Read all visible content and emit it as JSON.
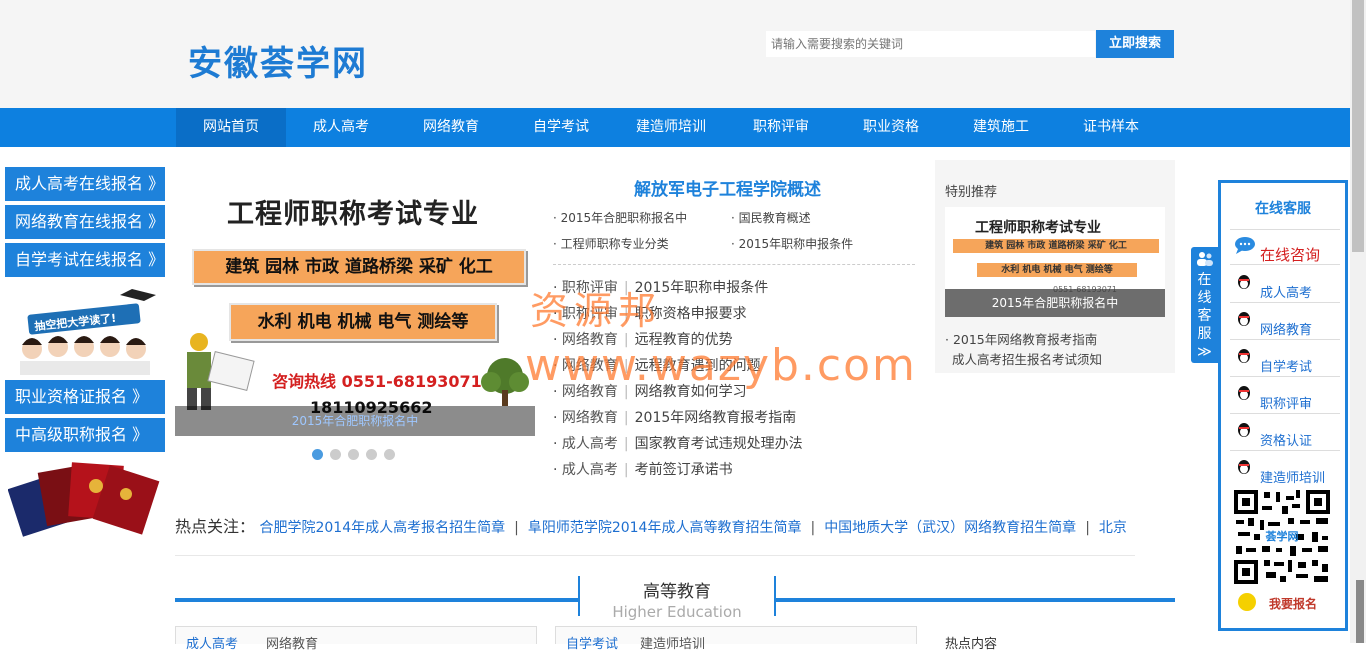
{
  "header": {
    "logo": "安徽荟学网",
    "search_placeholder": "请输入需要搜索的关键词",
    "search_button": "立即搜索"
  },
  "nav": [
    "网站首页",
    "成人高考",
    "网络教育",
    "自学考试",
    "建造师培训",
    "职称评审",
    "职业资格",
    "建筑施工",
    "证书样本"
  ],
  "left_buttons": [
    "成人高考在线报名 》",
    "网络教育在线报名 》",
    "自学考试在线报名 》",
    "职业资格证报名 》",
    "中高级职称报名 》"
  ],
  "promo_text": "抽空把大学读了!",
  "banner": {
    "title": "工程师职称考试专业",
    "tag1": "建筑 园林 市政 道路桥梁 采矿 化工",
    "tag2": "水利 机电 机械 电气 测绘等",
    "hotline": "咨询热线  0551-68193071",
    "phone2": "18110925662",
    "caption": "2015年合肥职称报名中"
  },
  "news": {
    "headline": "解放军电子工程学院概述",
    "top_links": [
      "2015年合肥职称报名中",
      "国民教育概述",
      "工程师职称专业分类",
      "2015年职称申报条件"
    ],
    "rows": [
      {
        "cat": "职称评审",
        "title": "2015年职称申报条件"
      },
      {
        "cat": "职称评审",
        "title": "职称资格申报要求"
      },
      {
        "cat": "网络教育",
        "title": "远程教育的优势"
      },
      {
        "cat": "网络教育",
        "title": "远程教育遇到的问题"
      },
      {
        "cat": "网络教育",
        "title": "网络教育如何学习"
      },
      {
        "cat": "网络教育",
        "title": "2015年网络教育报考指南"
      },
      {
        "cat": "成人高考",
        "title": "国家教育考试违规处理办法"
      },
      {
        "cat": "成人高考",
        "title": "考前签订承诺书"
      }
    ]
  },
  "recommend": {
    "title": "特别推荐",
    "img_title": "工程师职称考试专业",
    "img_tag1": "建筑 园林 市政 道路桥梁 采矿 化工",
    "img_tag2": "水利 机电 机械 电气 测绘等",
    "img_phone": "0551-68193071",
    "img_caption": "2015年合肥职称报名中",
    "items": [
      "· 2015年网络教育报考指南",
      "成人高考招生报名考试须知"
    ]
  },
  "hot": {
    "label": "热点关注：",
    "links": [
      "合肥学院2014年成人高考报名招生简章",
      "阜阳师范学院2014年成人高等教育招生简章",
      "中国地质大学（武汉）网络教育招生简章",
      "北京"
    ]
  },
  "section": {
    "title_cn": "高等教育",
    "title_en": "Higher Education"
  },
  "tabs": {
    "left": [
      "成人高考",
      "网络教育"
    ],
    "mid": [
      "自学考试",
      "建造师培训"
    ],
    "right": "热点内容"
  },
  "float_tab": [
    "在",
    "线",
    "客",
    "服",
    "≫"
  ],
  "cs": {
    "title": "在线客服",
    "consult": "在线咨询",
    "items": [
      "成人高考",
      "网络教育",
      "自学考试",
      "职称评审",
      "资格认证",
      "建造师培训"
    ],
    "qr_text": "荟学网",
    "signup": "我要报名"
  },
  "watermark": {
    "line1": "资源邦",
    "line2": "www.wazyb.com"
  },
  "colors": {
    "primary": "#1e82db",
    "nav": "#0d80e0",
    "accent": "#d42020",
    "banner_tag": "#f6a55a"
  }
}
